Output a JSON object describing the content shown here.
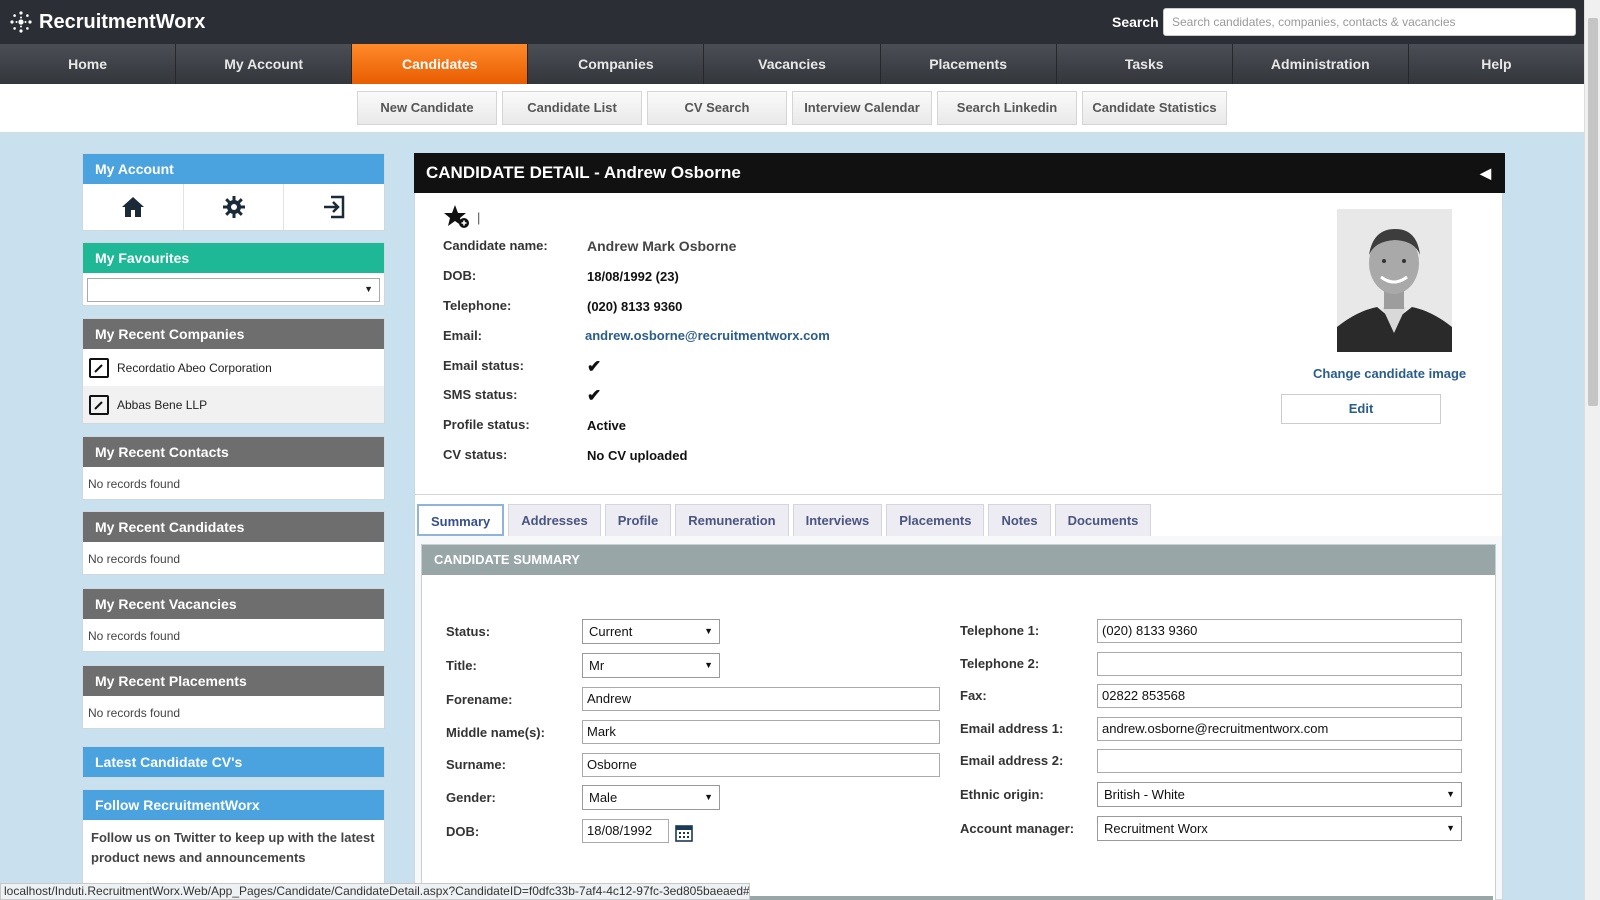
{
  "app": {
    "title": "RecruitmentWorx"
  },
  "search": {
    "label": "Search",
    "placeholder": "Search candidates, companies, contacts & vacancies"
  },
  "nav": {
    "items": [
      "Home",
      "My Account",
      "Candidates",
      "Companies",
      "Vacancies",
      "Placements",
      "Tasks",
      "Administration",
      "Help"
    ],
    "active": "Candidates"
  },
  "subnav": {
    "items": [
      "New Candidate",
      "Candidate List",
      "CV Search",
      "Interview Calendar",
      "Search Linkedin",
      "Candidate Statistics"
    ]
  },
  "sidebar": {
    "my_account": {
      "title": "My Account",
      "icons": [
        "home-icon",
        "gear-icon",
        "logout-icon"
      ]
    },
    "favourites": {
      "title": "My Favourites",
      "selected": ""
    },
    "recent_companies": {
      "title": "My Recent Companies",
      "items": [
        "Recordatio Abeo Corporation",
        "Abbas Bene LLP"
      ]
    },
    "recent_contacts": {
      "title": "My Recent Contacts",
      "empty": "No records found"
    },
    "recent_candidates": {
      "title": "My Recent Candidates",
      "empty": "No records found"
    },
    "recent_vacancies": {
      "title": "My Recent Vacancies",
      "empty": "No records found"
    },
    "recent_placements": {
      "title": "My Recent Placements",
      "empty": "No records found"
    },
    "latest_cvs": {
      "title": "Latest Candidate CV's"
    },
    "follow": {
      "title": "Follow RecruitmentWorx",
      "text": "Follow us on Twitter to keep up with the latest product news and announcements"
    }
  },
  "detail": {
    "title": "CANDIDATE DETAIL - Andrew Osborne",
    "fields": [
      {
        "label": "Candidate name:",
        "value": "Andrew Mark Osborne"
      },
      {
        "label": "DOB:",
        "value": "18/08/1992 (23)"
      },
      {
        "label": "Telephone:",
        "value": "(020) 8133 9360"
      },
      {
        "label": "Email:",
        "value": "andrew.osborne@recruitmentworx.com"
      },
      {
        "label": "Email status:",
        "value": "✔"
      },
      {
        "label": "SMS status:",
        "value": "✔"
      },
      {
        "label": "Profile status:",
        "value": "Active"
      },
      {
        "label": "CV status:",
        "value": "No CV uploaded"
      }
    ],
    "change_image": "Change candidate image",
    "edit_label": "Edit",
    "separator": "|"
  },
  "tabs": {
    "items": [
      "Summary",
      "Addresses",
      "Profile",
      "Remuneration",
      "Interviews",
      "Placements",
      "Notes",
      "Documents"
    ],
    "active": "Summary"
  },
  "summary": {
    "title": "CANDIDATE SUMMARY",
    "left": {
      "status": {
        "label": "Status:",
        "value": "Current"
      },
      "title": {
        "label": "Title:",
        "value": "Mr"
      },
      "forename": {
        "label": "Forename:",
        "value": "Andrew"
      },
      "middle": {
        "label": "Middle name(s):",
        "value": "Mark"
      },
      "surname": {
        "label": "Surname:",
        "value": "Osborne"
      },
      "gender": {
        "label": "Gender:",
        "value": "Male"
      },
      "dob": {
        "label": "DOB:",
        "value": "18/08/1992"
      }
    },
    "right": {
      "tel1": {
        "label": "Telephone 1:",
        "value": "(020) 8133 9360"
      },
      "tel2": {
        "label": "Telephone 2:",
        "value": ""
      },
      "fax": {
        "label": "Fax:",
        "value": "02822 853568"
      },
      "email1": {
        "label": "Email address 1:",
        "value": "andrew.osborne@recruitmentworx.com"
      },
      "email2": {
        "label": "Email address 2:",
        "value": ""
      },
      "ethnic": {
        "label": "Ethnic origin:",
        "value": "British - White"
      },
      "manager": {
        "label": "Account manager:",
        "value": "Recruitment Worx"
      }
    }
  },
  "statusbar": {
    "url": "localhost/Induti.RecruitmentWorx.Web/App_Pages/Candidate/CandidateDetail.aspx?CandidateID=f0dfc33b-7af4-4c12-97fc-3ed805baeaed#"
  },
  "colors": {
    "accent": "#e85d00",
    "blue": "#4aa3df",
    "green": "#1fb896",
    "dark": "#2b2e34"
  }
}
